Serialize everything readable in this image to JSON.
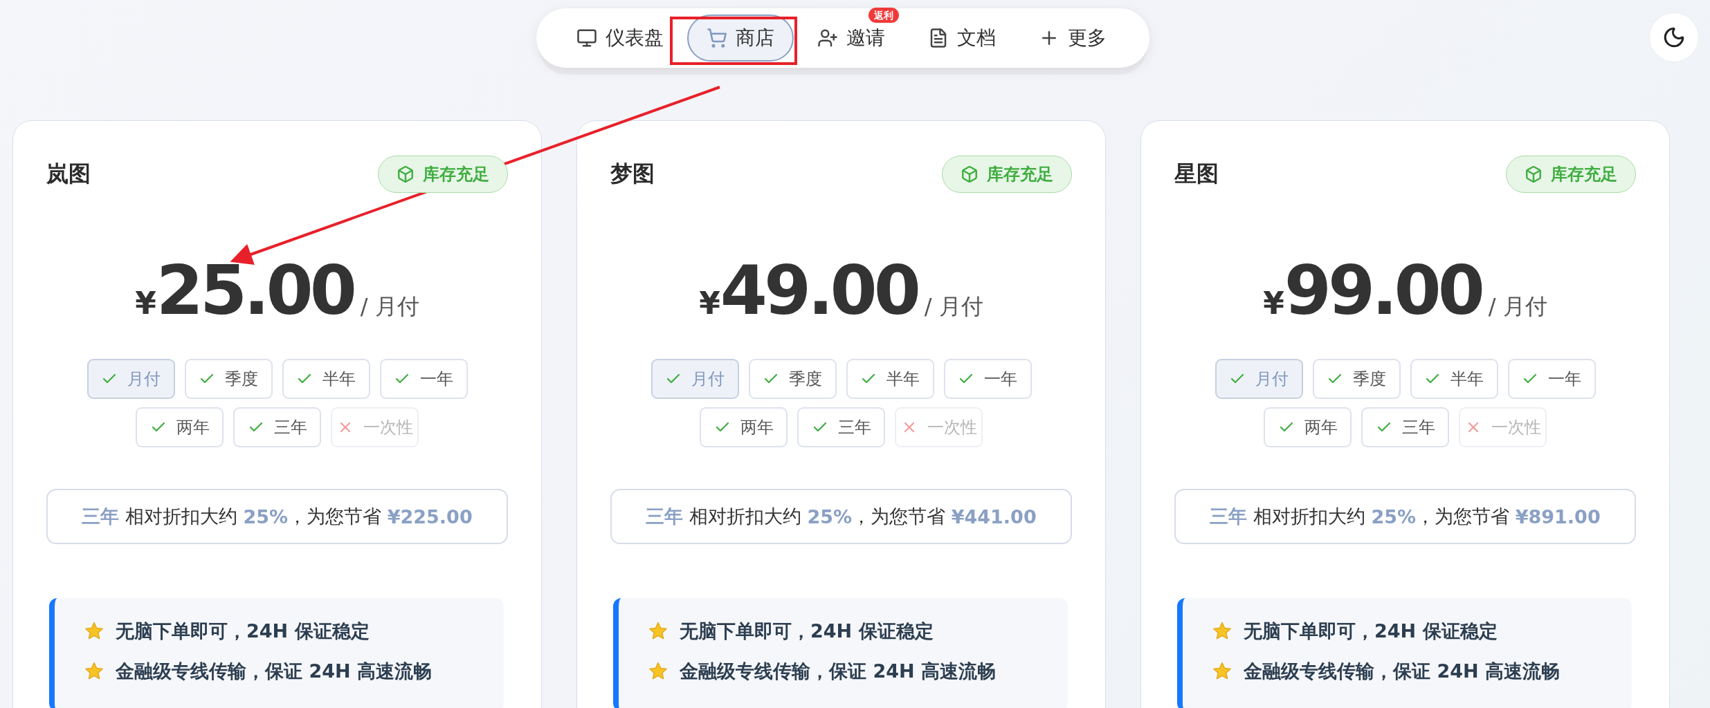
{
  "nav": {
    "items": [
      {
        "label": "仪表盘",
        "selected": false
      },
      {
        "label": "商店",
        "selected": true
      },
      {
        "label": "邀请",
        "selected": false,
        "badge": "返利"
      },
      {
        "label": "文档",
        "selected": false
      },
      {
        "label": "更多",
        "selected": false
      }
    ]
  },
  "plans": [
    {
      "name": "岚图",
      "stock": "库存充足",
      "currency": "¥",
      "amount": "25.00",
      "unit": "/ 月付",
      "options": [
        {
          "label": "月付",
          "selected": true,
          "available": true
        },
        {
          "label": "季度",
          "selected": false,
          "available": true
        },
        {
          "label": "半年",
          "selected": false,
          "available": true
        },
        {
          "label": "一年",
          "selected": false,
          "available": true
        },
        {
          "label": "两年",
          "selected": false,
          "available": true
        },
        {
          "label": "三年",
          "selected": false,
          "available": true
        },
        {
          "label": "一次性",
          "selected": false,
          "available": false
        }
      ],
      "savings": {
        "period": "三年",
        "text_1": "相对折扣大约",
        "percent": "25%",
        "text_2": "，为您节省",
        "amount": "¥225.00"
      },
      "features": [
        "无脑下单即可，24H 保证稳定",
        "金融级专线传输，保证 24H 高速流畅"
      ]
    },
    {
      "name": "梦图",
      "stock": "库存充足",
      "currency": "¥",
      "amount": "49.00",
      "unit": "/ 月付",
      "options": [
        {
          "label": "月付",
          "selected": true,
          "available": true
        },
        {
          "label": "季度",
          "selected": false,
          "available": true
        },
        {
          "label": "半年",
          "selected": false,
          "available": true
        },
        {
          "label": "一年",
          "selected": false,
          "available": true
        },
        {
          "label": "两年",
          "selected": false,
          "available": true
        },
        {
          "label": "三年",
          "selected": false,
          "available": true
        },
        {
          "label": "一次性",
          "selected": false,
          "available": false
        }
      ],
      "savings": {
        "period": "三年",
        "text_1": "相对折扣大约",
        "percent": "25%",
        "text_2": "，为您节省",
        "amount": "¥441.00"
      },
      "features": [
        "无脑下单即可，24H 保证稳定",
        "金融级专线传输，保证 24H 高速流畅"
      ]
    },
    {
      "name": "星图",
      "stock": "库存充足",
      "currency": "¥",
      "amount": "99.00",
      "unit": "/ 月付",
      "options": [
        {
          "label": "月付",
          "selected": true,
          "available": true
        },
        {
          "label": "季度",
          "selected": false,
          "available": true
        },
        {
          "label": "半年",
          "selected": false,
          "available": true
        },
        {
          "label": "一年",
          "selected": false,
          "available": true
        },
        {
          "label": "两年",
          "selected": false,
          "available": true
        },
        {
          "label": "三年",
          "selected": false,
          "available": true
        },
        {
          "label": "一次性",
          "selected": false,
          "available": false
        }
      ],
      "savings": {
        "period": "三年",
        "text_1": "相对折扣大约",
        "percent": "25%",
        "text_2": "，为您节省",
        "amount": "¥891.00"
      },
      "features": [
        "无脑下单即可，24H 保证稳定",
        "金融级专线传输，保证 24H 高速流畅"
      ]
    }
  ]
}
